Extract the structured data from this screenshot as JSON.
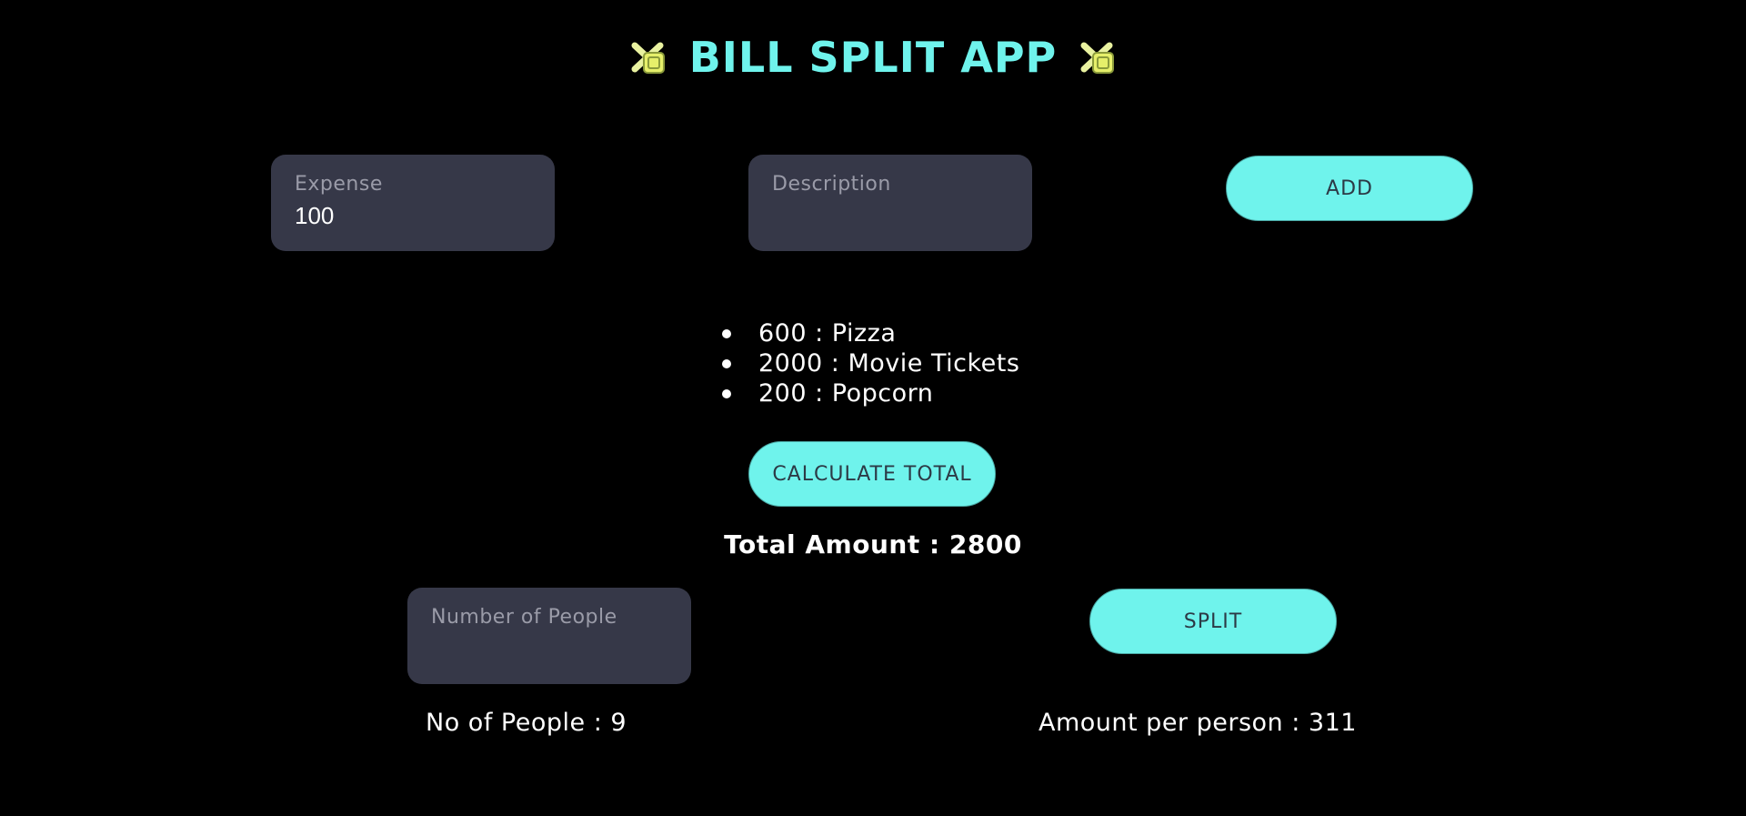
{
  "header": {
    "title": "BILL SPLIT APP",
    "icon": "cross-coins-icon"
  },
  "expense_form": {
    "expense": {
      "placeholder": "Expense",
      "value": "100"
    },
    "description": {
      "placeholder": "Description",
      "value": ""
    },
    "add_label": "ADD"
  },
  "expenses": [
    {
      "amount": "600",
      "separator": ":",
      "description": "Pizza",
      "text": "600 : Pizza"
    },
    {
      "amount": "2000",
      "separator": ":",
      "description": "Movie Tickets",
      "text": "2000 : Movie Tickets"
    },
    {
      "amount": "200",
      "separator": ":",
      "description": "Popcorn",
      "text": "200 : Popcorn"
    }
  ],
  "calculate_label": "CALCULATE TOTAL",
  "total_text": "Total Amount : 2800",
  "split_form": {
    "people": {
      "placeholder": "Number of People",
      "value": ""
    },
    "split_label": "SPLIT"
  },
  "results": {
    "people_text": "No of People : 9",
    "per_person_text": "Amount per person : 311"
  },
  "colors": {
    "background": "#000000",
    "accent": "#6ff3ec",
    "field_bg": "#363848",
    "button_text": "#2c3a46"
  }
}
